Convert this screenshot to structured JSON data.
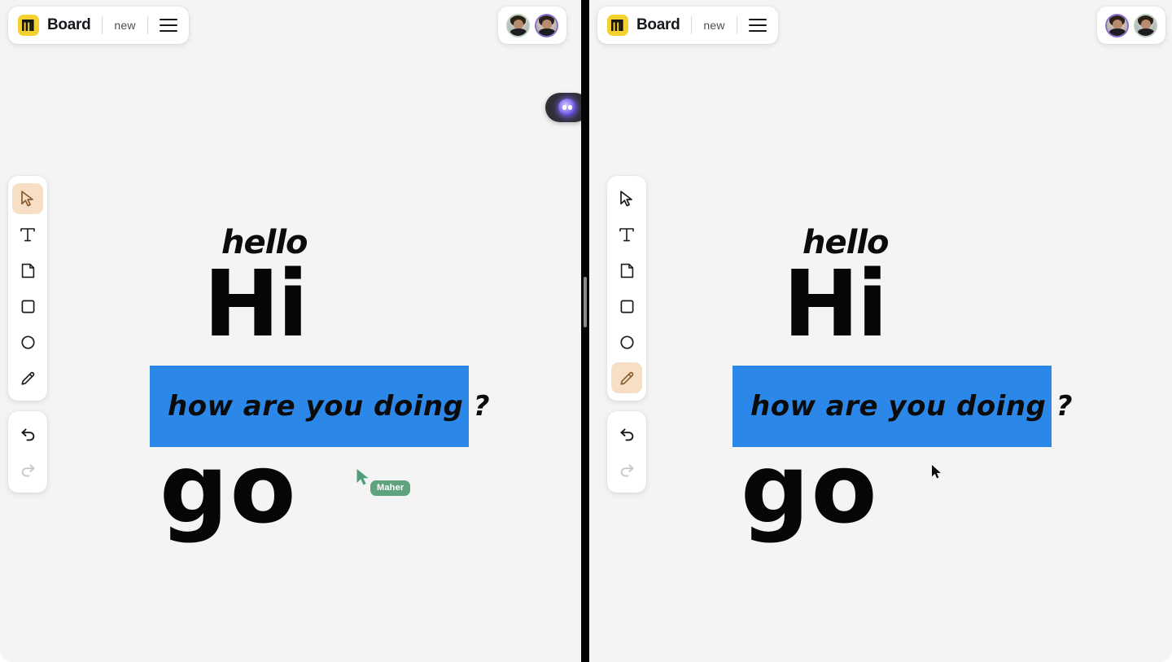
{
  "app": {
    "brand": "Board",
    "document_name": "new",
    "logo_icon": "board-logo-icon",
    "menu_icon": "hamburger-menu-icon",
    "background_color": "#f4f4f4",
    "accent_highlight_color": "#2C88E8",
    "tool_selected_color": "#F6DFC4",
    "logo_color": "#F5D130"
  },
  "divider": {
    "name": "pane-divider",
    "handle": "drag-handle",
    "color": "#050505"
  },
  "ai_assistant": {
    "name": "ai-assistant-button",
    "icon": "ai-orb-icon",
    "pill_color": "#2e3036"
  },
  "tools": {
    "items": [
      {
        "id": "select",
        "icon": "cursor-arrow-icon",
        "label": "Select"
      },
      {
        "id": "text",
        "icon": "text-icon",
        "label": "Text"
      },
      {
        "id": "note",
        "icon": "note-page-icon",
        "label": "Note"
      },
      {
        "id": "square",
        "icon": "square-icon",
        "label": "Rectangle"
      },
      {
        "id": "circle",
        "icon": "circle-icon",
        "label": "Ellipse"
      },
      {
        "id": "pencil",
        "icon": "pencil-icon",
        "label": "Draw"
      }
    ],
    "history": [
      {
        "id": "undo",
        "icon": "undo-arrow-icon",
        "label": "Undo",
        "enabled": true
      },
      {
        "id": "redo",
        "icon": "redo-arrow-icon",
        "label": "Redo",
        "enabled": false
      }
    ]
  },
  "panes": [
    {
      "id": "left",
      "selected_tool": "select",
      "avatars": [
        {
          "name": "avatar-user-1",
          "ring_color": "#b9cfc0",
          "face": "a"
        },
        {
          "name": "avatar-user-2",
          "ring_color": "#8a6fd0",
          "face": "b"
        }
      ],
      "canvas": {
        "hello": "hello",
        "hi": "Hi",
        "highlight_text": "how are you doing ?",
        "go": "go"
      },
      "cursor": {
        "type": "collaborator",
        "label": "Maher",
        "color": "#5FA37E"
      }
    },
    {
      "id": "right",
      "selected_tool": "pencil",
      "avatars": [
        {
          "name": "avatar-user-2",
          "ring_color": "#8a6fd0",
          "face": "b"
        },
        {
          "name": "avatar-user-1",
          "ring_color": "#b9cfc0",
          "face": "a"
        }
      ],
      "canvas": {
        "hello": "hello",
        "hi": "Hi",
        "highlight_text": "how are you doing ?",
        "go": "go"
      },
      "cursor": {
        "type": "pointer",
        "label": "",
        "color": "#000000"
      }
    }
  ]
}
